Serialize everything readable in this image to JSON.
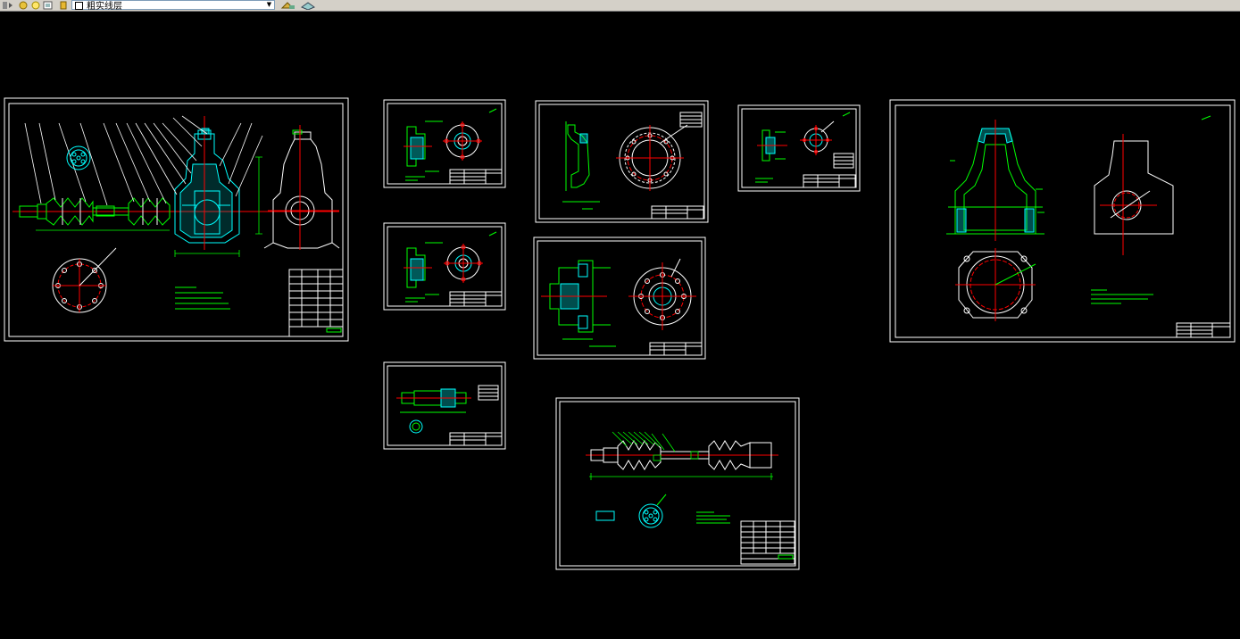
{
  "toolbar": {
    "layer_name": "粗实线层",
    "icons": [
      "layer-off-icon",
      "freeze-icon",
      "lock-icon",
      "color-swatch-icon",
      "make-current-icon",
      "layer-previous-icon"
    ]
  },
  "canvas": {
    "background": "#000000",
    "frame_color": "#ffffff",
    "geometry_color": "#00ff00",
    "section_color": "#00ffff",
    "centerline_color": "#ff0000",
    "sheets": [
      {
        "name": "sheet-assembly-drawing",
        "content": "final-drive-assembly"
      },
      {
        "name": "sheet-flange-small-a",
        "content": "flange-part"
      },
      {
        "name": "sheet-flange-small-b",
        "content": "flange-part"
      },
      {
        "name": "sheet-shaft-small",
        "content": "shaft-part"
      },
      {
        "name": "sheet-ring-gear",
        "content": "ring-gear-part"
      },
      {
        "name": "sheet-hub-flange",
        "content": "hub-part"
      },
      {
        "name": "sheet-flange-small-c",
        "content": "flange-part"
      },
      {
        "name": "sheet-housing",
        "content": "housing-part"
      },
      {
        "name": "sheet-halfshaft",
        "content": "halfshaft-assembly"
      }
    ]
  }
}
